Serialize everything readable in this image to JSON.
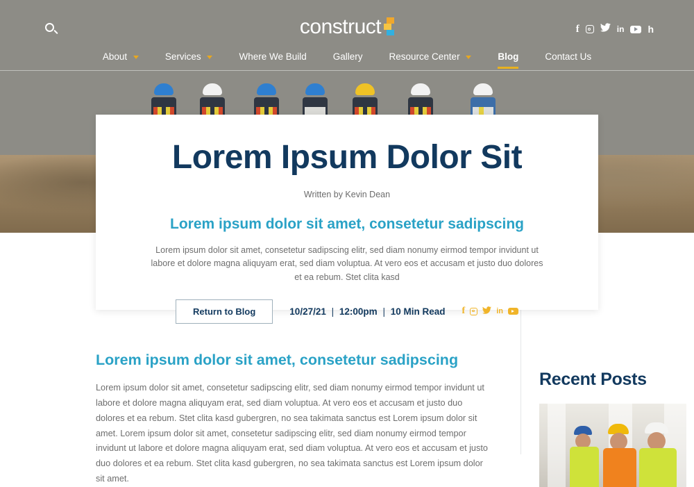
{
  "brand": {
    "name": "construct",
    "logo_icon": "stacked-blocks-logo",
    "colors": {
      "navy": "#12395e",
      "teal": "#2aa2c6",
      "gold": "#e8b11f",
      "orange": "#f0a72c",
      "blue": "#32b0e0"
    }
  },
  "topbar": {
    "search_icon": "search-icon",
    "social": [
      {
        "name": "facebook-icon",
        "glyph": "f"
      },
      {
        "name": "instagram-icon",
        "glyph": "◎"
      },
      {
        "name": "twitter-icon",
        "glyph": "t"
      },
      {
        "name": "linkedin-icon",
        "glyph": "in"
      },
      {
        "name": "youtube-icon",
        "glyph": "▶"
      },
      {
        "name": "houzz-icon",
        "glyph": "h"
      }
    ]
  },
  "nav": {
    "items": [
      {
        "label": "About",
        "caret": true,
        "active": false
      },
      {
        "label": "Services",
        "caret": true,
        "active": false
      },
      {
        "label": "Where We Build",
        "caret": false,
        "active": false
      },
      {
        "label": "Gallery",
        "caret": false,
        "active": false
      },
      {
        "label": "Resource Center",
        "caret": true,
        "active": false
      },
      {
        "label": "Blog",
        "caret": false,
        "active": true
      },
      {
        "label": "Contact Us",
        "caret": false,
        "active": false
      }
    ]
  },
  "hero_card": {
    "title": "Lorem Ipsum Dolor Sit",
    "author": "Written by Kevin Dean",
    "subtitle": "Lorem ipsum dolor sit amet, consetetur sadipscing",
    "body": "Lorem ipsum dolor sit amet, consetetur sadipscing elitr, sed diam nonumy eirmod tempor invidunt ut labore et dolore magna aliquyam erat, sed diam voluptua. At vero eos et accusam et justo duo dolores et ea rebum. Stet clita kasd",
    "button_label": "Return to Blog",
    "meta": {
      "date": "10/27/21",
      "time": "12:00pm",
      "read_time": "10 Min Read",
      "separator": "|"
    },
    "social": [
      {
        "name": "facebook-icon",
        "glyph": "f"
      },
      {
        "name": "instagram-icon",
        "glyph": "◎"
      },
      {
        "name": "twitter-icon",
        "glyph": "t"
      },
      {
        "name": "linkedin-icon",
        "glyph": "in"
      },
      {
        "name": "youtube-icon",
        "glyph": "▶"
      }
    ]
  },
  "article": {
    "heading": "Lorem ipsum dolor sit amet, consetetur sadipscing",
    "paragraph": "Lorem ipsum dolor sit amet, consetetur sadipscing elitr, sed diam nonumy eirmod tempor invidunt ut labore et dolore magna aliquyam erat, sed diam voluptua. At vero eos et accusam et justo duo dolores et ea rebum. Stet clita kasd gubergren, no sea takimata sanctus est Lorem ipsum dolor sit amet. Lorem ipsum dolor sit amet, consetetur sadipscing elitr, sed diam nonumy eirmod tempor invidunt ut labore et dolore magna aliquyam erat, sed diam voluptua. At vero eos et accusam et justo duo dolores et ea rebum. Stet clita kasd gubergren, no sea takimata sanctus est Lorem ipsum dolor sit amet."
  },
  "sidebar": {
    "title": "Recent Posts",
    "thumbnail_alt": "three-construction-workers-photo"
  },
  "hero_image_alt": "construction-site-workers-photo"
}
